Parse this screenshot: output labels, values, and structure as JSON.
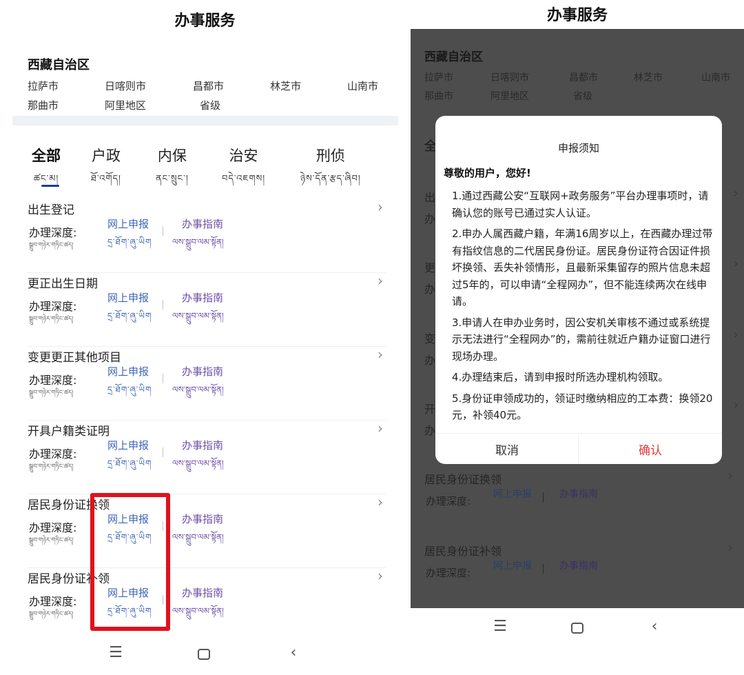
{
  "left": {
    "title": "办事服务",
    "region": "西藏自治区",
    "cities": [
      "拉萨市",
      "日喀则市",
      "昌都市",
      "林芝市",
      "山南市",
      "那曲市",
      "阿里地区",
      "省级"
    ],
    "tabs": [
      {
        "zh": "全部",
        "bo": "ཚང་མ།"
      },
      {
        "zh": "户政",
        "bo": "ཐོ་འགོད།"
      },
      {
        "zh": "内保",
        "bo": "ནང་སྲུང་།"
      },
      {
        "zh": "治安",
        "bo": "བདེ་འཇགས།"
      },
      {
        "zh": "刑侦",
        "bo": "ཉེས་དོན་རྩད་ཞིབ།"
      }
    ],
    "items": [
      {
        "name": "出生登记"
      },
      {
        "name": "更正出生日期"
      },
      {
        "name": "变更更正其他项目"
      },
      {
        "name": "开具户籍类证明"
      },
      {
        "name": "居民身份证换领"
      },
      {
        "name": "居民身份证补领"
      }
    ],
    "depth_label": "办理深度:",
    "depth_bo": "སྒྲུབ་གཉེར་གཏིང་ཚད།",
    "online_label": "网上申报",
    "online_bo": "དྲ་ཐོག་ཞུ་ཡིག",
    "guide_label": "办事指南",
    "guide_bo": "ལས་སྒྲུབ་ལམ་སྟོན།"
  },
  "right": {
    "title": "办事服务",
    "region": "西藏自治区",
    "cities": [
      "拉萨市",
      "日喀则市",
      "昌都市",
      "林芝市",
      "山南市",
      "那曲市",
      "阿里地区",
      "省级"
    ],
    "items": [
      {
        "name": "居民身份证换领"
      },
      {
        "name": "居民身份证补领"
      }
    ],
    "peek_chars": [
      "全",
      "出",
      "办",
      "更",
      "办",
      "变",
      "办",
      "开",
      "办"
    ],
    "dialog": {
      "title": "申报须知",
      "greeting": "尊敬的用户，您好!",
      "paragraphs": [
        "1.通过西藏公安“互联网+政务服务”平台办理事项时，请确认您的账号已通过实人认证。",
        "2.申办人属西藏户籍，年满16周岁以上，在西藏办理过带有指纹信息的二代居民身份证。居民身份证符合因证件损坏换领、丢失补领情形，且最新采集留存的照片信息未超过5年的，可以申请“全程网办”，但不能连续两次在线申请。",
        "3.申请人在申办业务时，因公安机关审核不通过或系统提示无法进行“全程网办”的，需前往就近户籍办证窗口进行现场办理。",
        "4.办理结束后，请到申报时所选办理机构领取。",
        "5.身份证申领成功的，领证时缴纳相应的工本费：换领20元，补领40元。"
      ],
      "cancel": "取消",
      "confirm": "确认"
    }
  },
  "colors": {
    "accent_blue": "#3d66b8",
    "guide_purple": "#6a4fa6",
    "highlight_red": "#e0121c",
    "confirm_red": "#e23a3a",
    "overlay": "#4d4d4d"
  },
  "icons": [
    "chevron-right-icon",
    "menu-icon",
    "home-icon",
    "back-icon"
  ]
}
